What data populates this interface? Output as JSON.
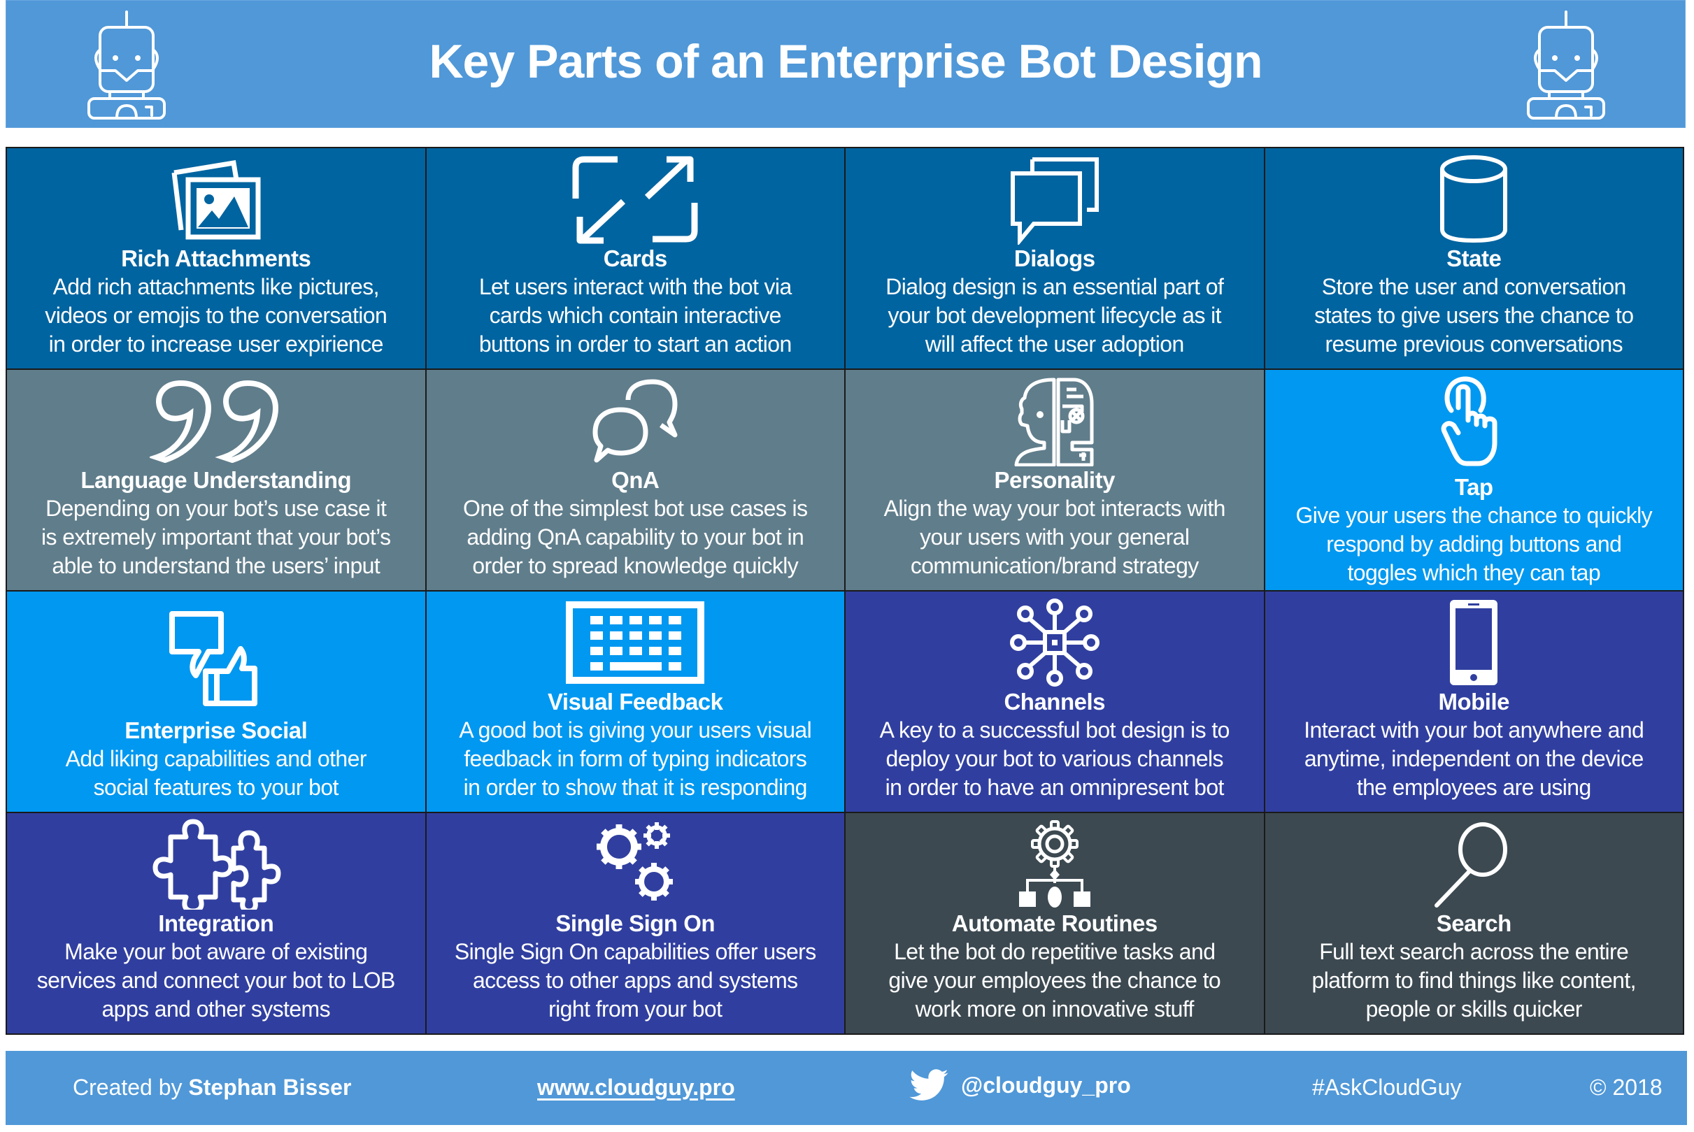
{
  "header": {
    "title": "Key Parts of an Enterprise Bot Design",
    "left_icon": "robot-icon",
    "right_icon": "robot-icon"
  },
  "colors": {
    "header_footer": "#5098d8",
    "dark_blue": "#0064a0",
    "slate_gray": "#607d8b",
    "bright_blue": "#0098f0",
    "indigo": "#303f9f",
    "charcoal": "#3c4951"
  },
  "cards": [
    {
      "title": "Rich Attachments",
      "icon": "pictures-icon",
      "color": "#0064a0",
      "description": "Add rich attachments like pictures,\nvideos or emojis to the conversation\nin order to increase user expirience"
    },
    {
      "title": "Cards",
      "icon": "expand-arrows-icon",
      "color": "#0064a0",
      "description": "Let users interact with the bot via\ncards which contain interactive\nbuttons in order to start an action"
    },
    {
      "title": "Dialogs",
      "icon": "dialog-bubbles-icon",
      "color": "#0064a0",
      "description": "Dialog design is an essential part of\nyour bot development lifecycle as it\nwill affect the user adoption"
    },
    {
      "title": "State",
      "icon": "database-cylinder-icon",
      "color": "#0064a0",
      "description": "Store the user and conversation\nstates to give users the chance to\nresume previous conversations"
    },
    {
      "title": "Language Understanding",
      "icon": "quote-marks-icon",
      "color": "#607d8b",
      "description": "Depending on your bot’s use case it\nis extremely important that your bot’s\nable to understand the users’ input"
    },
    {
      "title": "QnA",
      "icon": "chat-bubbles-icon",
      "color": "#607d8b",
      "description": "One of the simplest bot use cases is\nadding QnA capability to your bot in\norder to spread knowledge quickly"
    },
    {
      "title": "Personality",
      "icon": "human-robot-head-icon",
      "color": "#607d8b",
      "description": "Align the way your bot interacts with\nyour users with your general\ncommunication/brand strategy"
    },
    {
      "title": "Tap",
      "icon": "tap-finger-icon",
      "color": "#0098f0",
      "description": "Give your users the chance to quickly\nrespond by adding buttons and\ntoggles which they can tap"
    },
    {
      "title": "Enterprise Social",
      "icon": "thumbs-up-down-icon",
      "color": "#0098f0",
      "description": "Add liking capabilities and other\nsocial features to your bot"
    },
    {
      "title": "Visual Feedback",
      "icon": "keyboard-icon",
      "color": "#0098f0",
      "description": "A good bot is giving your users visual\nfeedback in form of typing indicators\nin order to show that it is responding"
    },
    {
      "title": "Channels",
      "icon": "network-hub-icon",
      "color": "#303f9f",
      "description": "A key to a successful bot design is to\ndeploy your bot to various channels\nin order to have an omnipresent bot"
    },
    {
      "title": "Mobile",
      "icon": "smartphone-icon",
      "color": "#303f9f",
      "description": "Interact with your bot anywhere and\nanytime, independent on the device\nthe employees are using"
    },
    {
      "title": "Integration",
      "icon": "puzzle-pieces-icon",
      "color": "#303f9f",
      "description": "Make your bot aware of existing\nservices and connect your bot to LOB\napps and other systems"
    },
    {
      "title": "Single Sign On",
      "icon": "gears-icon",
      "color": "#303f9f",
      "description": "Single Sign On capabilities offer users\naccess to other apps and systems\nright from your bot"
    },
    {
      "title": "Automate Routines",
      "icon": "gear-workflow-icon",
      "color": "#3c4951",
      "description": "Let the bot do repetitive tasks and\ngive your employees the chance to\nwork more on innovative stuff"
    },
    {
      "title": "Search",
      "icon": "magnifier-icon",
      "color": "#3c4951",
      "description": "Full text search across the entire\nplatform to find things like content,\npeople or skills quicker"
    }
  ],
  "footer": {
    "created_prefix": "Created by ",
    "author": "Stephan Bisser",
    "website": "www.cloudguy.pro",
    "twitter_icon": "twitter-bird-icon",
    "twitter_handle": "@cloudguy_pro",
    "hashtag": "#AskCloudGuy",
    "copyright": "© 2018"
  }
}
